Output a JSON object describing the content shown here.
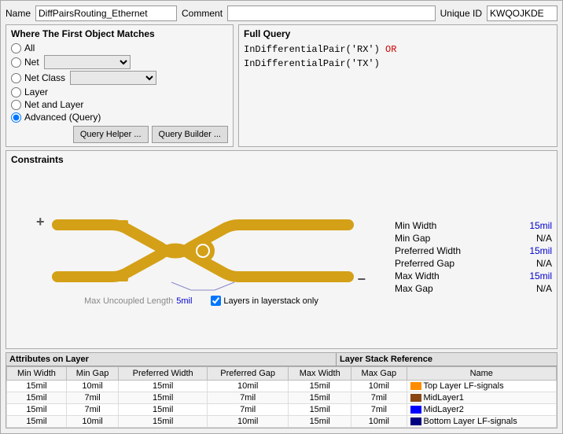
{
  "header": {
    "name_label": "Name",
    "name_value": "DiffPairsRouting_Ethernet",
    "comment_label": "Comment",
    "comment_value": "",
    "uniqueid_label": "Unique ID",
    "uniqueid_value": "KWQOJKDE"
  },
  "where_panel": {
    "title": "Where The First Object Matches",
    "options": [
      {
        "id": "all",
        "label": "All",
        "has_dropdown": false
      },
      {
        "id": "net",
        "label": "Net",
        "has_dropdown": true
      },
      {
        "id": "netclass",
        "label": "Net Class",
        "has_dropdown": true
      },
      {
        "id": "layer",
        "label": "Layer",
        "has_dropdown": false
      },
      {
        "id": "netandlayer",
        "label": "Net and Layer",
        "has_dropdown": false
      },
      {
        "id": "advanced",
        "label": "Advanced (Query)",
        "has_dropdown": false,
        "checked": true
      }
    ],
    "query_helper_btn": "Query Helper ...",
    "query_builder_btn": "Query Builder ..."
  },
  "full_query": {
    "title": "Full Query",
    "line1_black": "InDifferentialPair('RX')",
    "line1_red": " OR",
    "line2_black": "InDifferentialPair('TX')"
  },
  "constraints": {
    "title": "Constraints",
    "min_width_label": "Min Width",
    "min_width_value": "15mil",
    "min_gap_label": "Min Gap",
    "min_gap_value": "N/A",
    "pref_width_label": "Preferred Width",
    "pref_width_value": "15mil",
    "pref_gap_label": "Preferred Gap",
    "pref_gap_value": "N/A",
    "max_width_label": "Max Width",
    "max_width_value": "15mil",
    "max_gap_label": "Max Gap",
    "max_gap_value": "N/A",
    "max_uncoupled_label": "Max Uncoupled Length",
    "max_uncoupled_value": "5mil",
    "layers_check_label": "Layers in layerstack only",
    "layers_checked": true
  },
  "attributes_table": {
    "left_header": "Attributes on Layer",
    "right_header": "Layer Stack Reference",
    "columns": [
      "Min Width",
      "Min Gap",
      "Preferred Width",
      "Preferred Gap",
      "Max Width",
      "Max Gap",
      "Name"
    ],
    "rows": [
      {
        "min_width": "15mil",
        "min_gap": "10mil",
        "pref_width": "15mil",
        "pref_gap": "10mil",
        "max_width": "15mil",
        "max_gap": "10mil",
        "color": "#FF8C00",
        "name": "Top Layer LF-signals"
      },
      {
        "min_width": "15mil",
        "min_gap": "7mil",
        "pref_width": "15mil",
        "pref_gap": "7mil",
        "max_width": "15mil",
        "max_gap": "7mil",
        "color": "#8B4513",
        "name": "MidLayer1"
      },
      {
        "min_width": "15mil",
        "min_gap": "7mil",
        "pref_width": "15mil",
        "pref_gap": "7mil",
        "max_width": "15mil",
        "max_gap": "7mil",
        "color": "#0000FF",
        "name": "MidLayer2"
      },
      {
        "min_width": "15mil",
        "min_gap": "10mil",
        "pref_width": "15mil",
        "pref_gap": "10mil",
        "max_width": "15mil",
        "max_gap": "10mil",
        "color": "#000080",
        "name": "Bottom Layer LF-signals"
      }
    ]
  }
}
